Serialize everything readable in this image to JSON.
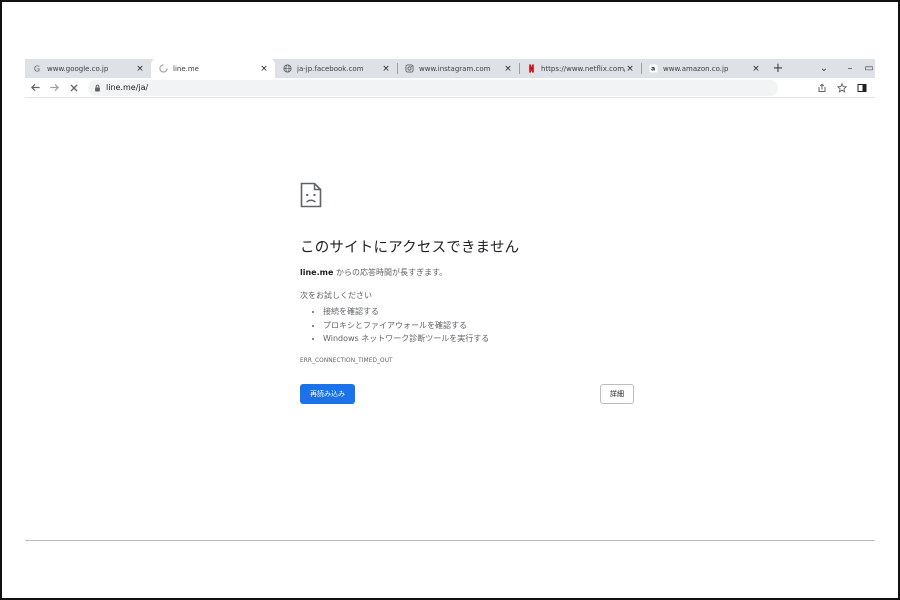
{
  "tabs": [
    {
      "title": "www.google.co.jp",
      "icon": "google-icon",
      "active": false
    },
    {
      "title": "line.me",
      "icon": "loading-spinner-icon",
      "active": true
    },
    {
      "title": "ja-jp.facebook.com",
      "icon": "globe-icon",
      "active": false
    },
    {
      "title": "www.instagram.com",
      "icon": "instagram-icon",
      "active": false
    },
    {
      "title": "https://www.netflix.com/brow",
      "icon": "netflix-icon",
      "active": false
    },
    {
      "title": "www.amazon.co.jp",
      "icon": "amazon-icon",
      "active": false
    }
  ],
  "tab_close_glyph": "×",
  "new_tab_glyph": "+",
  "window_controls": {
    "tab_search": "⌄",
    "minimize": "–",
    "restore": "▭"
  },
  "address_bar": {
    "url": "line.me/ja/"
  },
  "error": {
    "heading": "このサイトにアクセスできません",
    "summary_host": "line.me",
    "summary_rest": " からの応答時間が長すぎます。",
    "try_label": "次をお試しください",
    "suggestions": [
      "接続を確認する",
      "プロキシとファイアウォールを確認する",
      "Windows ネットワーク診断ツールを実行する"
    ],
    "code": "ERR_CONNECTION_TIMED_OUT",
    "reload_label": "再読み込み",
    "details_label": "詳細"
  },
  "colors": {
    "accent": "#1a73e8",
    "tabstrip": "#dee1e6",
    "netflix": "#e50914"
  }
}
